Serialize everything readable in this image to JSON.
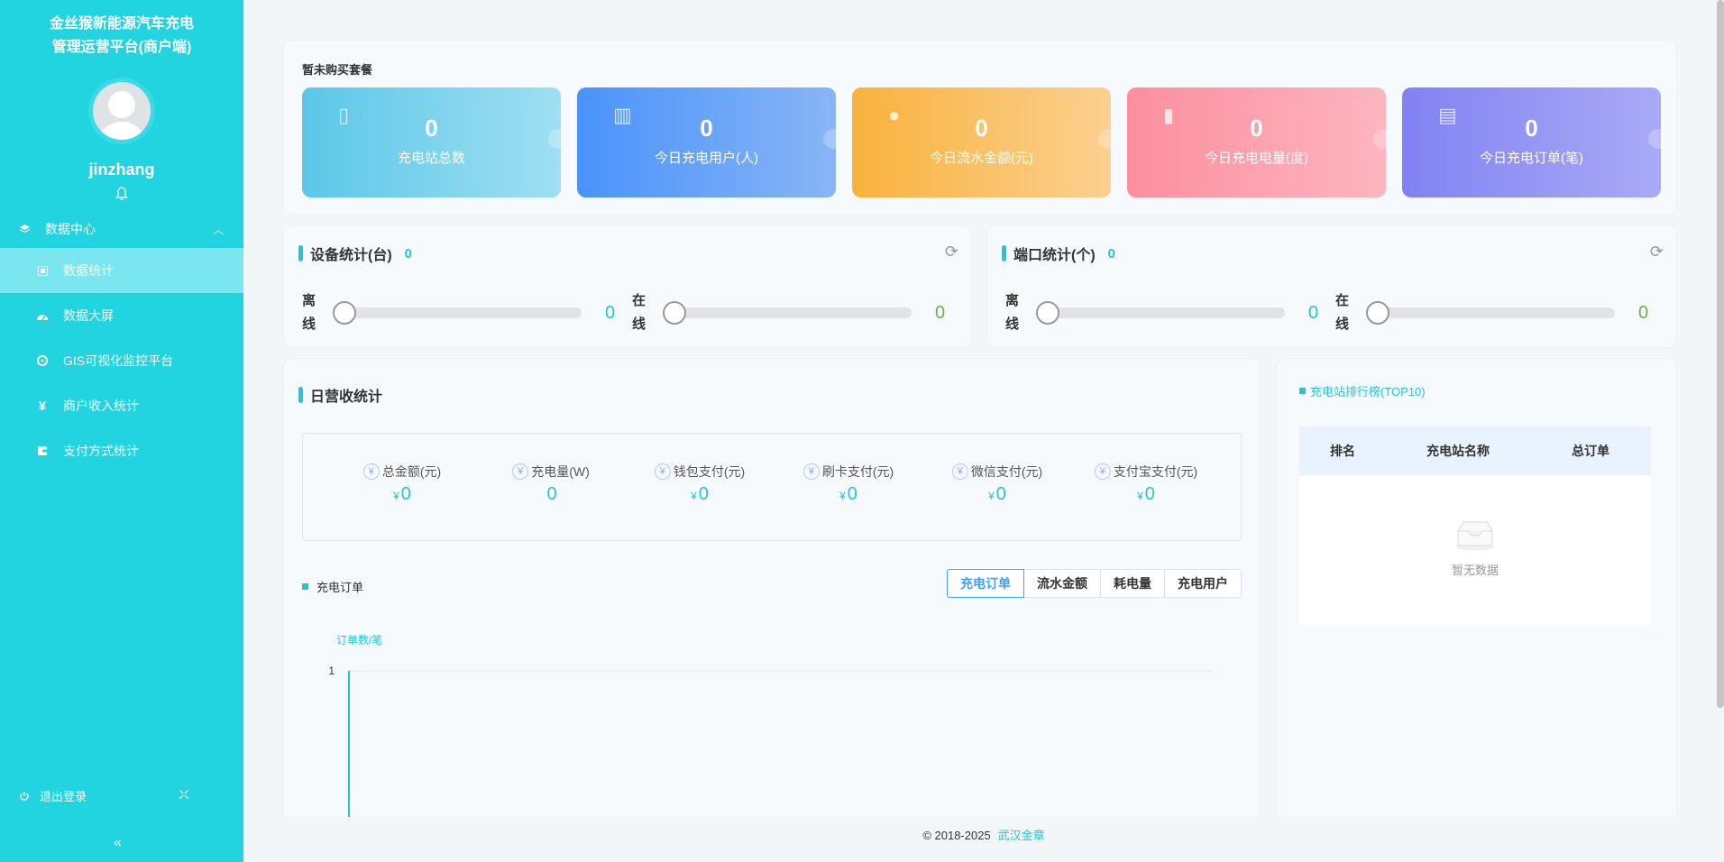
{
  "sidebar": {
    "brand_line1": "金丝猴新能源汽车充电",
    "brand_line2": "管理运营平台(商户端)",
    "username": "jinzhang",
    "group": {
      "label": "数据中心",
      "icon": "layers-icon"
    },
    "items": [
      {
        "label": "数据统计",
        "icon": "chart-icon",
        "active": true
      },
      {
        "label": "数据大屏",
        "icon": "dashboard-icon"
      },
      {
        "label": "GIS可视化监控平台",
        "icon": "target-icon"
      },
      {
        "label": "商户收入统计",
        "icon": "yen-icon"
      },
      {
        "label": "支付方式统计",
        "icon": "wallet-icon"
      }
    ],
    "logout": "退出登录"
  },
  "package": {
    "title": "暂未购买套餐",
    "stats": [
      {
        "value": "0",
        "label": "充电站总数",
        "icon": "charger-icon",
        "color": "#5bc7e8"
      },
      {
        "value": "0",
        "label": "今日充电用户(人)",
        "icon": "building-icon",
        "color": "#4a93fb"
      },
      {
        "value": "0",
        "label": "今日流水金额(元)",
        "icon": "money-bag-icon",
        "color": "#f9b23c"
      },
      {
        "value": "0",
        "label": "今日充电电量(度)",
        "icon": "battery-icon",
        "color": "#fd8e9e"
      },
      {
        "value": "0",
        "label": "今日充电订单(笔)",
        "icon": "order-icon",
        "color": "#8182f2"
      }
    ]
  },
  "device": {
    "title": "设备统计(台)",
    "count": "0",
    "offline_label": "离线",
    "offline_value": "0",
    "online_label": "在线",
    "online_value": "0"
  },
  "port": {
    "title": "端口统计(个)",
    "count": "0",
    "offline_label": "离线",
    "offline_value": "0",
    "online_label": "在线",
    "online_value": "0"
  },
  "revenue": {
    "title": "日营收统计",
    "summary": [
      {
        "label": "总金额(元)",
        "currency": "¥",
        "value": "0"
      },
      {
        "label": "充电量(W)",
        "currency": "",
        "value": "0"
      },
      {
        "label": "钱包支付(元)",
        "currency": "¥",
        "value": "0"
      },
      {
        "label": "刷卡支付(元)",
        "currency": "¥",
        "value": "0"
      },
      {
        "label": "微信支付(元)",
        "currency": "¥",
        "value": "0"
      },
      {
        "label": "支付宝支付(元)",
        "currency": "¥",
        "value": "0"
      }
    ],
    "chart_title": "充电订单",
    "tabs": [
      "充电订单",
      "流水金额",
      "耗电量",
      "充电用户"
    ],
    "active_tab": 0
  },
  "chart_data": {
    "type": "line",
    "ylabel": "订单数/笔",
    "yticks": [
      "1"
    ],
    "ylim": [
      0,
      1
    ],
    "x": [],
    "series": [
      {
        "values": []
      }
    ],
    "grid": true,
    "accent": "#22c6d8"
  },
  "ranking": {
    "title": "充电站排行榜(TOP10)",
    "columns": [
      "排名",
      "充电站名称",
      "总订单"
    ],
    "empty_text": "暂无数据"
  },
  "footer": {
    "copyright": "© 2018-2025",
    "company": "武汉金章"
  },
  "colors": {
    "sidebar": "#22d3e0",
    "accent": "#22c6d8",
    "online": "#6ab04c"
  }
}
